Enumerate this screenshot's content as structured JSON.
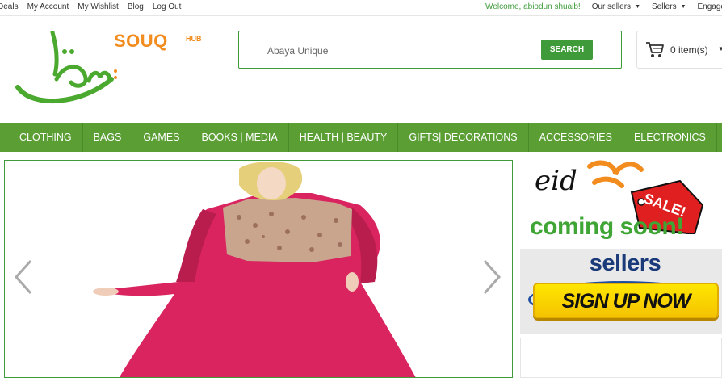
{
  "topbar": {
    "links": [
      "Deals",
      "My Account",
      "My Wishlist",
      "Blog",
      "Log Out"
    ],
    "welcome": "Welcome, abiodun shuaib!",
    "menus": [
      "Our sellers",
      "Sellers",
      "Engage"
    ]
  },
  "logo": {
    "brand": "SOUQ",
    "hub": "HUB"
  },
  "search": {
    "value": "Abaya Unique",
    "button_label": "SEARCH"
  },
  "cart": {
    "label": "0 item(s)"
  },
  "nav": {
    "items": [
      "CLOTHING",
      "BAGS",
      "GAMES",
      "BOOKS | MEDIA",
      "HEALTH | BEAUTY",
      "GIFTS| DECORATIONS",
      "ACCESSORIES",
      "ELECTRONICS"
    ]
  },
  "banners": {
    "eid": {
      "script": "eid",
      "tag": "SALE!",
      "subtitle": "coming soon!"
    },
    "sellers": {
      "title": "sellers",
      "button": "SIGN UP NOW"
    }
  },
  "colors": {
    "brand_green": "#3f9b3a",
    "nav_green": "#5a9e34",
    "brand_orange": "#f28c1e"
  }
}
